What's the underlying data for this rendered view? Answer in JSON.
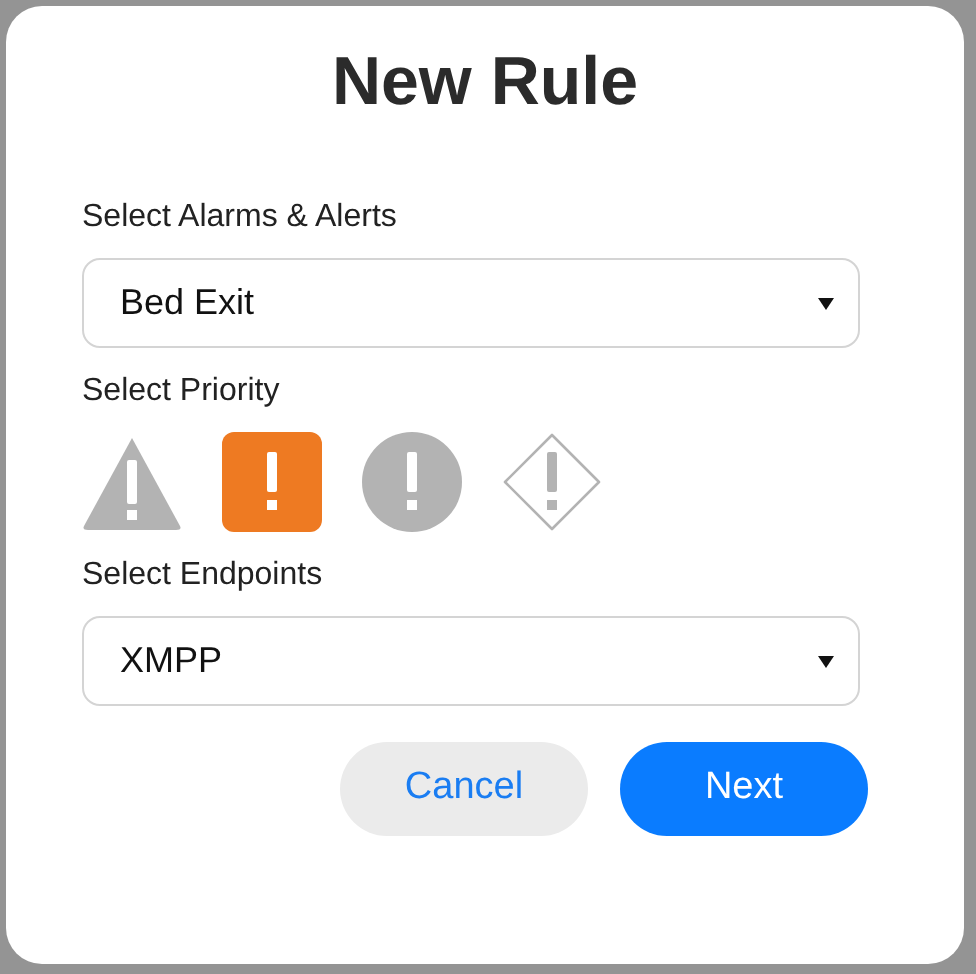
{
  "dialog": {
    "title": "New Rule",
    "alarms": {
      "label": "Select Alarms & Alerts",
      "value": "Bed Exit"
    },
    "priority": {
      "label": "Select Priority",
      "options": [
        {
          "kind": "triangle",
          "selected": false
        },
        {
          "kind": "square",
          "selected": true
        },
        {
          "kind": "circle",
          "selected": false
        },
        {
          "kind": "diamond",
          "selected": false
        }
      ]
    },
    "endpoints": {
      "label": "Select Endpoints",
      "value": "XMPP"
    },
    "buttons": [
      {
        "label": "Cancel",
        "kind": "secondary"
      },
      {
        "label": "Next",
        "kind": "primary"
      }
    ]
  }
}
